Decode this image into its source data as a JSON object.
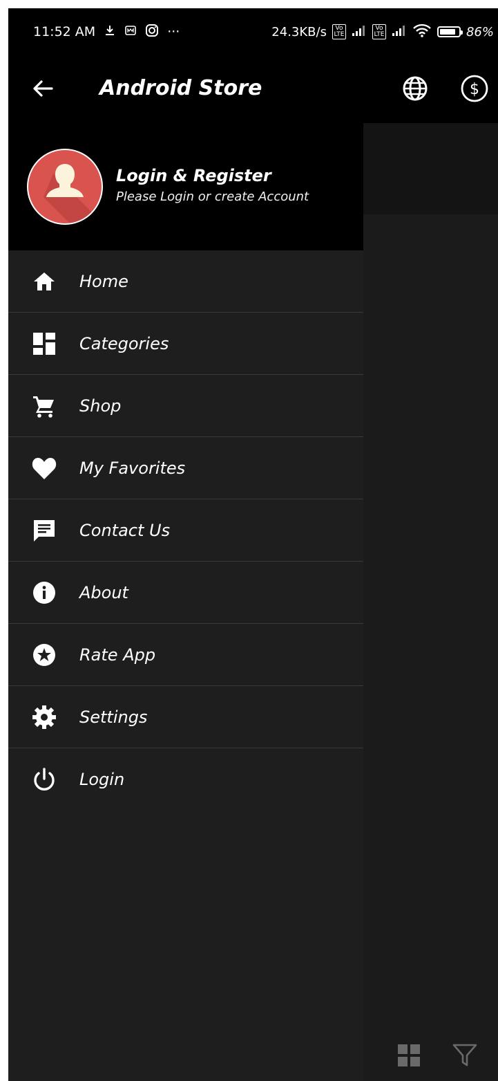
{
  "status_bar": {
    "time": "11:52 AM",
    "net_speed": "24.3KB/s",
    "lte_label": "Vo LTE",
    "battery": "86%",
    "battery_level": 0.86,
    "more": "···"
  },
  "app_bar": {
    "title": "Android Store",
    "icons": [
      "back-arrow-icon",
      "globe-icon",
      "dollar-icon"
    ]
  },
  "drawer": {
    "header": {
      "title": "Login & Register",
      "subtitle": "Please Login or create Account"
    },
    "items": [
      {
        "label": "Home",
        "icon": "home-icon"
      },
      {
        "label": "Categories",
        "icon": "dashboard-icon"
      },
      {
        "label": "Shop",
        "icon": "cart-icon"
      },
      {
        "label": "My Favorites",
        "icon": "heart-icon"
      },
      {
        "label": "Contact Us",
        "icon": "chat-icon"
      },
      {
        "label": "About",
        "icon": "info-icon"
      },
      {
        "label": "Rate App",
        "icon": "star-icon"
      },
      {
        "label": "Settings",
        "icon": "gear-icon"
      },
      {
        "label": "Login",
        "icon": "power-icon"
      }
    ]
  },
  "bottom_bar": {
    "icons": [
      "grid-view-icon",
      "filter-icon"
    ]
  },
  "colors": {
    "drawer_bg": "#1e1e1e",
    "header_bg": "#000000",
    "avatar_bg": "#d9534f",
    "divider": "#3a3a3a",
    "content_bg": "#1b1b1b"
  }
}
